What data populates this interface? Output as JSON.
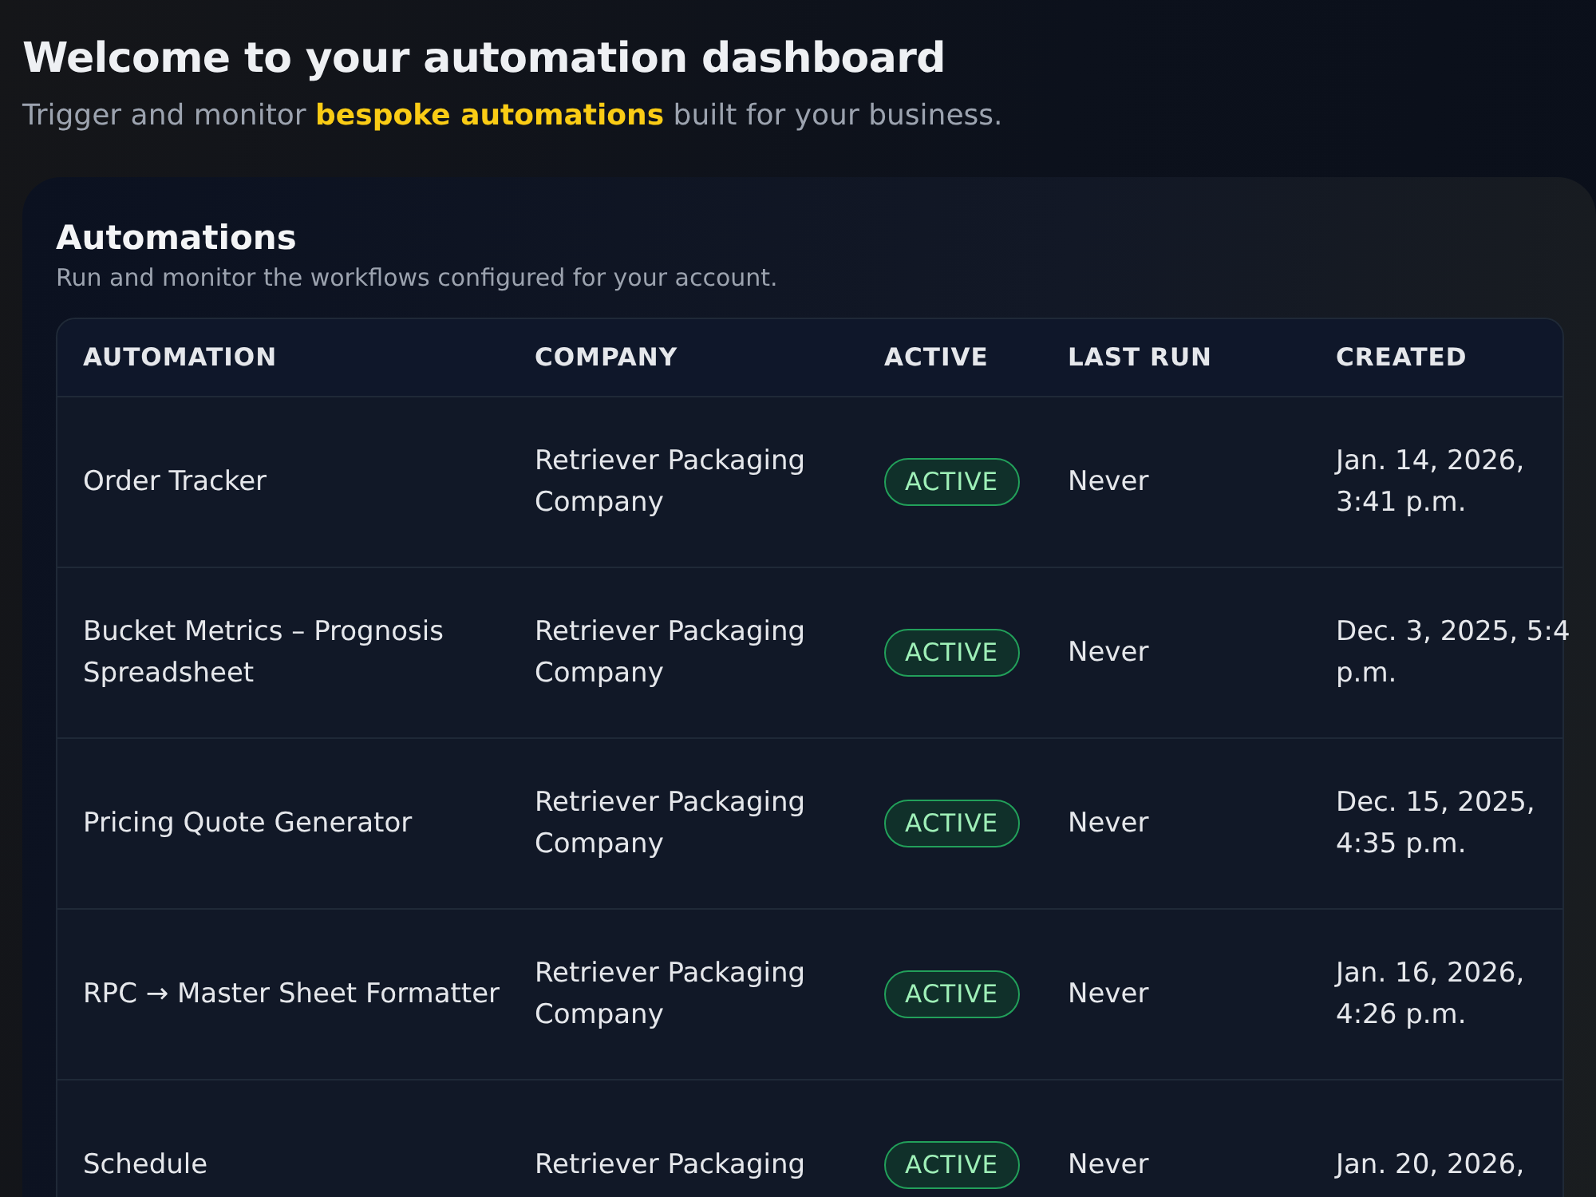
{
  "header": {
    "title": "Welcome to your automation dashboard",
    "subtitle": "Trigger and monitor **bespoke automations** built for your business."
  },
  "card": {
    "title": "Automations",
    "subtitle": "Run and monitor the workflows configured for your account."
  },
  "table": {
    "columns": [
      "AUTOMATION",
      "COMPANY",
      "ACTIVE",
      "LAST RUN",
      "CREATED"
    ],
    "rows": [
      {
        "automation": "Order Tracker",
        "company": "Retriever Packaging Company",
        "active": true,
        "badge": "ACTIVE",
        "last_run": "Never",
        "created": "Jan. 14, 2026,\n3:41 p.m."
      },
      {
        "automation": "Bucket Metrics – Prognosis Spreadsheet",
        "company": "Retriever Packaging Company",
        "active": true,
        "badge": "ACTIVE",
        "last_run": "Never",
        "created": "Dec. 3, 2025, 5:4\np.m."
      },
      {
        "automation": "Pricing Quote Generator",
        "company": "Retriever Packaging Company",
        "active": true,
        "badge": "ACTIVE",
        "last_run": "Never",
        "created": "Dec. 15, 2025,\n4:35 p.m."
      },
      {
        "automation": "RPC → Master Sheet Formatter",
        "company": "Retriever Packaging Company",
        "active": true,
        "badge": "ACTIVE",
        "last_run": "Never",
        "created": "Jan. 16, 2026,\n4:26 p.m."
      },
      {
        "automation": "Schedule",
        "company": "Retriever Packaging",
        "active": true,
        "badge": "ACTIVE",
        "last_run": "Never",
        "created": "Jan. 20, 2026,"
      }
    ]
  }
}
